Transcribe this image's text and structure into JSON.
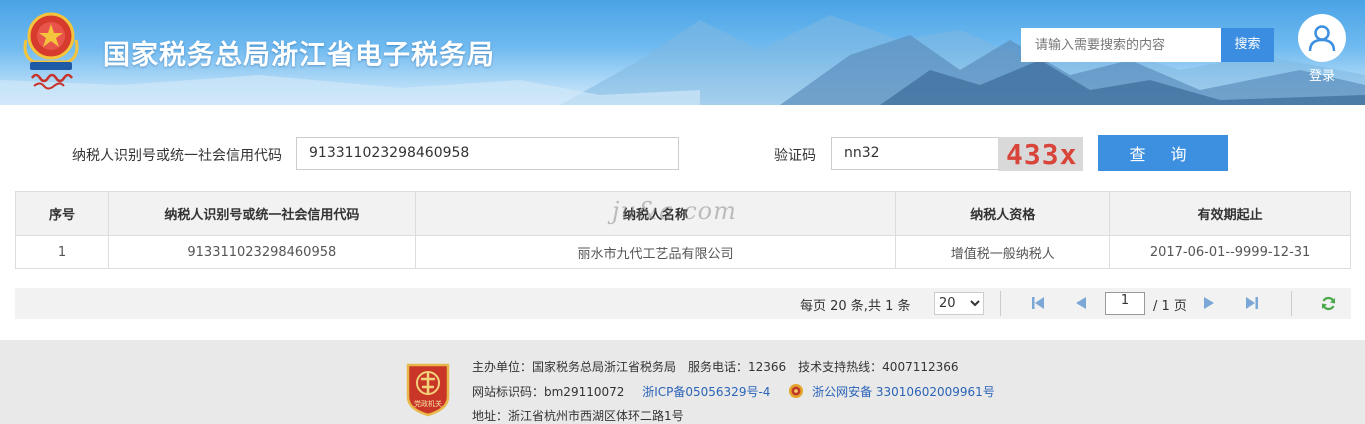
{
  "header": {
    "title": "国家税务总局浙江省电子税务局",
    "logo_icon": "tax-emblem-icon",
    "search": {
      "placeholder": "请输入需要搜索的内容",
      "button_label": "搜索"
    },
    "login_label": "登录"
  },
  "query": {
    "taxpayer_id_label": "纳税人识别号或统一社会信用代码",
    "taxpayer_id_value": "913311023298460958",
    "captcha_label": "验证码",
    "captcha_value": "nn32",
    "captcha_image_text": "433x",
    "submit_label": "查 询"
  },
  "table": {
    "columns": [
      "序号",
      "纳税人识别号或统一社会信用代码",
      "纳税人名称",
      "纳税人资格",
      "有效期起止"
    ],
    "rows": [
      [
        "1",
        "913311023298460958",
        "丽水市九代工艺品有限公司",
        "增值税一般纳税人",
        "2017-06-01--9999-12-31"
      ]
    ],
    "watermark": "ju&a.com"
  },
  "pager": {
    "info": "每页 20 条,共 1 条",
    "page_size": "20",
    "current_page": "1",
    "total_pages_text": "/ 1 页"
  },
  "footer": {
    "line1": "主办单位：国家税务总局浙江省税务局　服务电话：12366　技术支持热线：4007112366",
    "site_id": "网站标识码：bm29110072",
    "icp": "浙ICP备05056329号-4",
    "police": "浙公网安备 33010602009961号",
    "address": "地址：浙江省杭州市西湖区体环二路1号",
    "emblem_text": "党政机关"
  },
  "colors": {
    "accent": "#3d8fe0",
    "header_sky": "#4aa3e6",
    "captcha_text": "#d9443a",
    "link": "#2a63b8"
  }
}
